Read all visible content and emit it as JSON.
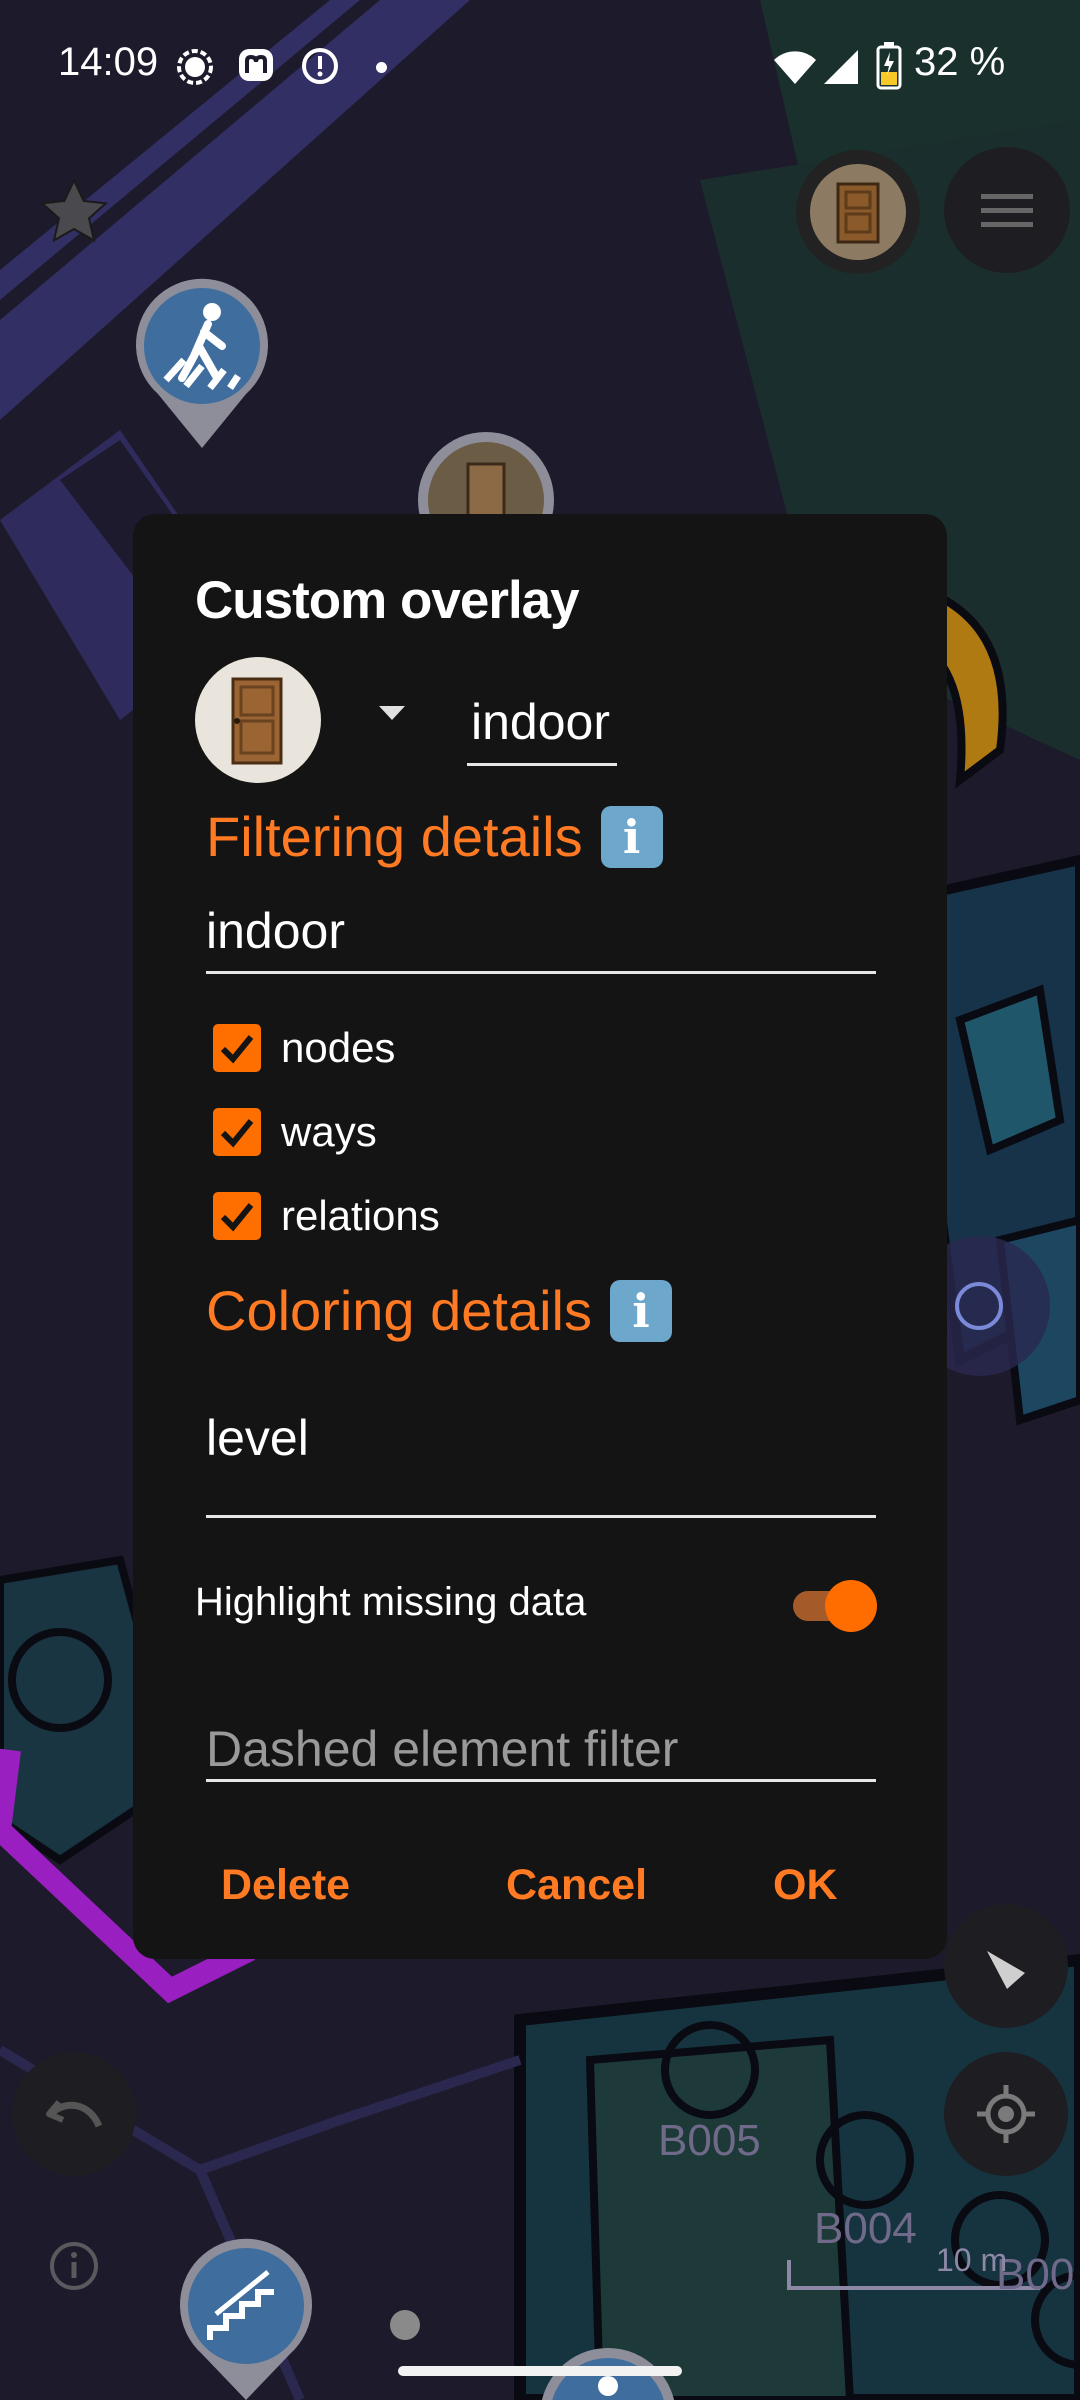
{
  "status_bar": {
    "time": "14:09",
    "battery_percent": "32 %",
    "icons": [
      "signal-messenger-icon",
      "mastodon-icon",
      "alert-circle-icon",
      "dot-icon",
      "wifi-icon",
      "cell-signal-icon",
      "battery-charging-icon"
    ]
  },
  "map": {
    "labels": [
      "B005",
      "B004",
      "B00"
    ],
    "scale_label": "10 m"
  },
  "dialog": {
    "title": "Custom overlay",
    "icon": "door-icon",
    "name_value": "indoor",
    "filtering": {
      "heading": "Filtering details",
      "filter_value": "indoor",
      "checkboxes": [
        {
          "label": "nodes",
          "checked": true
        },
        {
          "label": "ways",
          "checked": true
        },
        {
          "label": "relations",
          "checked": true
        }
      ]
    },
    "coloring": {
      "heading": "Coloring details",
      "value": "level"
    },
    "highlight": {
      "label": "Highlight missing data",
      "enabled": true
    },
    "dashed_filter": {
      "placeholder": "Dashed element filter",
      "value": ""
    },
    "buttons": {
      "delete": "Delete",
      "cancel": "Cancel",
      "ok": "OK"
    }
  },
  "colors": {
    "accent": "#ff7a22",
    "dialog_bg": "#141414",
    "map_bg": "#1d1a2b"
  }
}
